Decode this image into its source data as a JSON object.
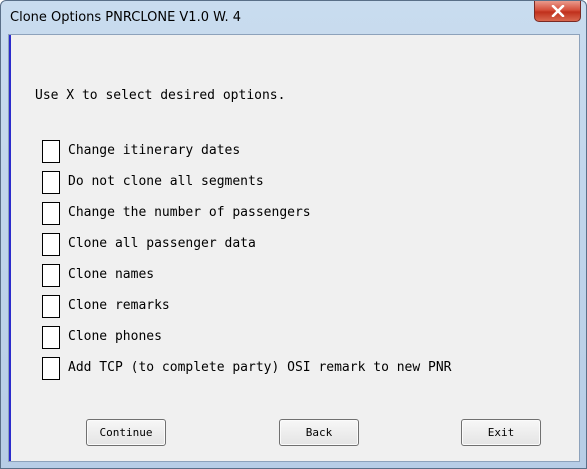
{
  "window": {
    "title": "Clone Options   PNRCLONE V1.0 W. 4"
  },
  "instruction": "Use X to select desired options.",
  "options": [
    {
      "label": "Change itinerary dates",
      "checked": ""
    },
    {
      "label": "Do not clone all segments",
      "checked": ""
    },
    {
      "label": "Change the number of passengers",
      "checked": ""
    },
    {
      "label": "Clone all passenger data",
      "checked": ""
    },
    {
      "label": "Clone names",
      "checked": ""
    },
    {
      "label": "Clone remarks",
      "checked": ""
    },
    {
      "label": "Clone phones",
      "checked": ""
    },
    {
      "label": "Add TCP (to complete party) OSI remark to new PNR",
      "checked": ""
    }
  ],
  "buttons": {
    "continue": "Continue",
    "back": "Back",
    "exit": "Exit"
  },
  "colors": {
    "close_button": "#c0301c",
    "left_bar": "#2b2bcc"
  }
}
